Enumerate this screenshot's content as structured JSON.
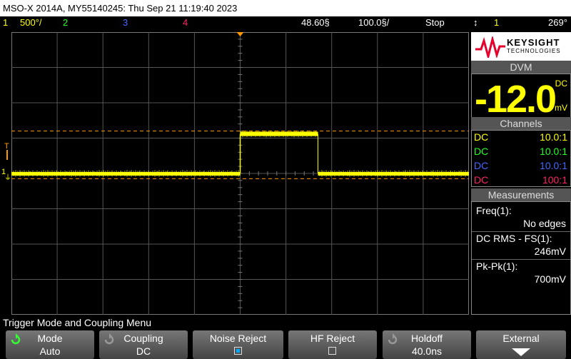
{
  "title": "MSO-X 2014A, MY55140245: Thu Sep 21 11:19:40 2023",
  "status": {
    "ch1_num": "1",
    "ch1_scale": "500°/",
    "ch2_num": "2",
    "ch3_num": "3",
    "ch4_num": "4",
    "time_pos": "48.60§",
    "time_scale": "100.0§/",
    "run_state": "Stop",
    "trig_channel": "1",
    "trig_level": "269°"
  },
  "markers": {
    "trigger_T": "T",
    "ch1_ground": "1"
  },
  "brand": {
    "line1": "KEYSIGHT",
    "line2": "TECHNOLOGIES"
  },
  "dvm": {
    "header": "DVM",
    "value": "-12.0",
    "unit": "mV",
    "mode": "DC"
  },
  "channels": {
    "header": "Channels",
    "rows": [
      {
        "coupling": "DC",
        "ratio": "10.0:1",
        "color": "#ffff00"
      },
      {
        "coupling": "DC",
        "ratio": "10.0:1",
        "color": "#22ff22"
      },
      {
        "coupling": "DC",
        "ratio": "10.0:1",
        "color": "#4466ff"
      },
      {
        "coupling": "DC",
        "ratio": "100:1",
        "color": "#ff2266"
      }
    ]
  },
  "measurements": {
    "header": "Measurements",
    "items": [
      {
        "label": "Freq(1):",
        "value": "No edges"
      },
      {
        "label": "DC RMS - FS(1):",
        "value": "246mV"
      },
      {
        "label": "Pk-Pk(1):",
        "value": "700mV"
      }
    ]
  },
  "menu_title": "Trigger Mode and Coupling Menu",
  "softkeys": [
    {
      "label": "Mode",
      "value": "Auto",
      "icon": "rotate-knob-icon"
    },
    {
      "label": "Coupling",
      "value": "DC",
      "icon": "rotate-knob-icon"
    },
    {
      "label": "Noise Reject",
      "checked": true
    },
    {
      "label": "HF Reject",
      "checked": false
    },
    {
      "label": "Holdoff",
      "value": "40.0ns",
      "icon": "rotate-knob-icon"
    },
    {
      "label": "External",
      "icon": "down-arrow-icon"
    }
  ],
  "colors": {
    "ch1": "#ffff00",
    "ch2": "#22ff22",
    "ch3": "#4466ff",
    "ch4": "#ff2266",
    "trigger_marker": "#ff9900",
    "dvm_value": "#ffff00"
  },
  "waveform": {
    "low_level_div": 0,
    "high_level_div": 1.12,
    "pulse_start_time_div": 0,
    "pulse_end_time_div": 1.7,
    "trigger_level_div": 1.2,
    "ground_level_div": -0.15
  }
}
